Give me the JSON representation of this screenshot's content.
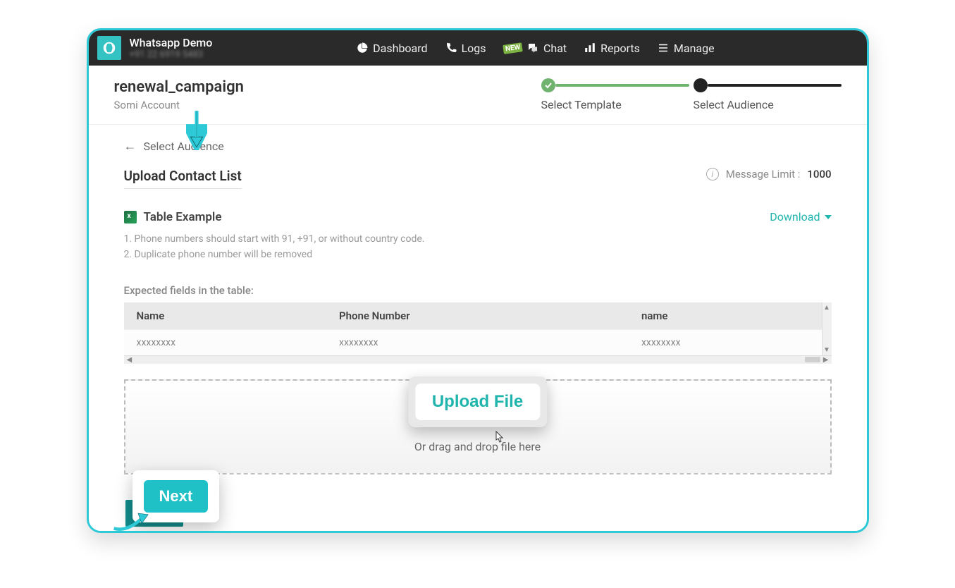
{
  "brand": {
    "title": "Whatsapp Demo",
    "sub": "+91 22 6919 5483"
  },
  "nav": {
    "dashboard": "Dashboard",
    "logs": "Logs",
    "chat": "Chat",
    "chat_badge": "NEW",
    "reports": "Reports",
    "manage": "Manage"
  },
  "header": {
    "campaign_name": "renewal_campaign",
    "account_name": "Somi Account"
  },
  "stepper": {
    "step1_label": "Select Template",
    "step2_label": "Select Audience"
  },
  "back": {
    "label": "Select Audience"
  },
  "section": {
    "title": "Upload Contact List",
    "limit_label": "Message Limit :",
    "limit_value": "1000"
  },
  "example": {
    "title": "Table Example",
    "note1": "1. Phone numbers should start with 91, +91, or without country code.",
    "note2": "2. Duplicate phone number will be removed",
    "download": "Download",
    "expected_label": "Expected fields in the table:",
    "columns": [
      "Name",
      "Phone Number",
      "name"
    ],
    "row": [
      "xxxxxxxx",
      "xxxxxxxx",
      "xxxxxxxx"
    ]
  },
  "dropzone": {
    "upload_button": "Upload File",
    "drag_text": "Or drag and drop file here"
  },
  "callouts": {
    "upload": "Upload File",
    "next": "Next"
  }
}
